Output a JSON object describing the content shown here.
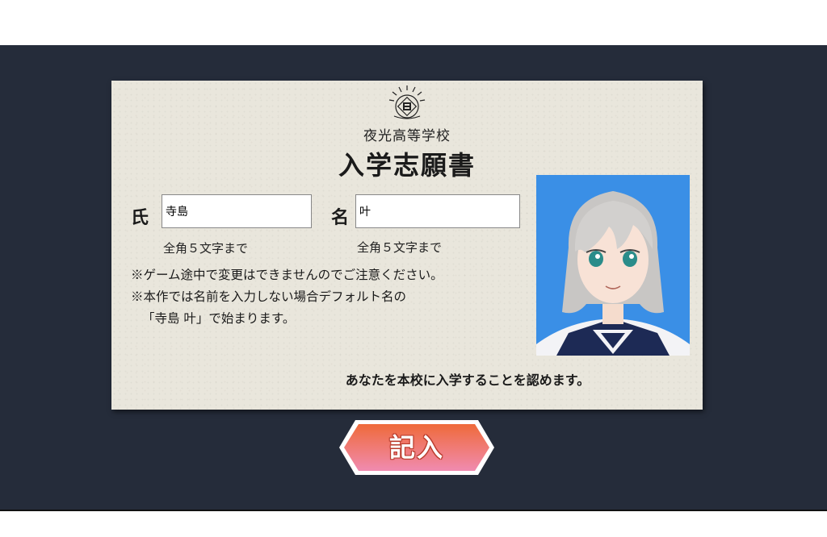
{
  "form": {
    "school_name": "夜光高等学校",
    "title": "入学志願書",
    "surname_label": "氏",
    "surname_value": "寺島",
    "given_label": "名",
    "given_value": "叶",
    "surname_hint": "全角５文字まで",
    "given_hint": "全角５文字まで",
    "notes": [
      "※ゲーム途中で変更はできませんのでご注意ください。",
      "※本作では名前を入力しない場合デフォルト名の",
      "「寺島 叶」で始まります。"
    ],
    "approval": "あなたを本校に入学することを認めます。"
  },
  "actions": {
    "submit_label": "記入"
  },
  "colors": {
    "stage": "#252c3a",
    "card": "#e9e6dc",
    "photo_bg": "#3a8fe6",
    "button_top": "#ef6a3a",
    "button_bottom": "#f08bb0"
  }
}
